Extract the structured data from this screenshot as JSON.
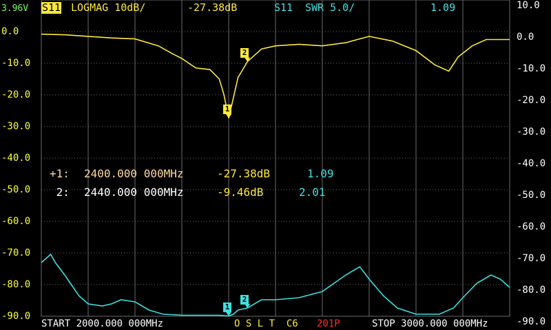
{
  "header": {
    "battery": "3.96V",
    "ch1_name": "S11",
    "ch1_format": "LOGMAG 10dB/",
    "ch1_value": "-27.38dB",
    "ch2_name": "S11",
    "ch2_format": "SWR 5.0/",
    "ch2_value": "1.09"
  },
  "colors": {
    "trace1": "#ffe93a",
    "trace2": "#3ee0e0",
    "grid": "#6c6c6c",
    "background": "#000000",
    "ch1_badge_bg": "#ffe93a",
    "points": "#ff2a2a"
  },
  "axis": {
    "left_labels": [
      "0.0",
      "-10.0",
      "-20.0",
      "-30.0",
      "-40.0",
      "-50.0",
      "-60.0",
      "-70.0",
      "-80.0",
      "-90.0"
    ],
    "right_labels": [
      "10.0",
      "0.0",
      "-10.0",
      "-20.0",
      "-30.0",
      "-40.0",
      "-50.0",
      "-60.0",
      "-70.0",
      "-80.0",
      "-90.0"
    ]
  },
  "markers": {
    "m1": {
      "symbol": "+1:",
      "freq": "2400.000 000MHz",
      "logmag": "-27.38dB",
      "swr": "1.09"
    },
    "m2": {
      "symbol": " 2:",
      "freq": "2440.000 000MHz",
      "logmag": "-9.46dB",
      "swr": "2.01"
    },
    "badge1": "1",
    "badge2": "2"
  },
  "footer": {
    "start": "START 2000.000 000MHz",
    "cal": "O S L T  C6",
    "points": "201P",
    "stop": "STOP 3000.000 000MHz"
  },
  "chart_data": {
    "type": "line",
    "x_unit": "MHz",
    "xlim": [
      2000,
      3000
    ],
    "series": [
      {
        "name": "S11 LOGMAG",
        "ylim": [
          -90,
          0
        ],
        "x": [
          2000,
          2050,
          2100,
          2150,
          2200,
          2250,
          2280,
          2300,
          2330,
          2360,
          2380,
          2390,
          2400,
          2410,
          2420,
          2440,
          2470,
          2500,
          2550,
          2600,
          2650,
          2700,
          2750,
          2800,
          2840,
          2870,
          2890,
          2920,
          2950,
          3000
        ],
        "y": [
          -0.8,
          -1.0,
          -1.5,
          -2.0,
          -2.3,
          -4.5,
          -7.0,
          -8.5,
          -11.5,
          -12.0,
          -15.0,
          -20.0,
          -27.4,
          -21.0,
          -14.5,
          -9.5,
          -5.5,
          -4.5,
          -4.0,
          -4.5,
          -3.5,
          -1.5,
          -3.0,
          -6.0,
          -10.5,
          -12.5,
          -8.0,
          -4.5,
          -2.5,
          -2.5
        ]
      },
      {
        "name": "S11 SWR",
        "ylim": [
          1,
          10
        ],
        "x": [
          2000,
          2010,
          2020,
          2030,
          2050,
          2080,
          2100,
          2130,
          2150,
          2170,
          2200,
          2230,
          2260,
          2300,
          2350,
          2380,
          2400,
          2410,
          2420,
          2440,
          2470,
          2500,
          2550,
          2600,
          2650,
          2680,
          2700,
          2730,
          2760,
          2800,
          2850,
          2880,
          2900,
          2930,
          2960,
          2980,
          3000
        ],
        "y": [
          3.6,
          3.8,
          4.0,
          3.6,
          3.0,
          2.0,
          1.6,
          1.5,
          1.6,
          1.8,
          1.7,
          1.3,
          1.1,
          1.05,
          1.05,
          1.05,
          1.01,
          1.1,
          1.3,
          1.4,
          1.8,
          1.8,
          1.9,
          2.2,
          3.0,
          3.4,
          2.8,
          2.0,
          1.4,
          1.1,
          1.1,
          1.4,
          1.9,
          2.6,
          3.0,
          2.8,
          2.4
        ]
      }
    ]
  }
}
